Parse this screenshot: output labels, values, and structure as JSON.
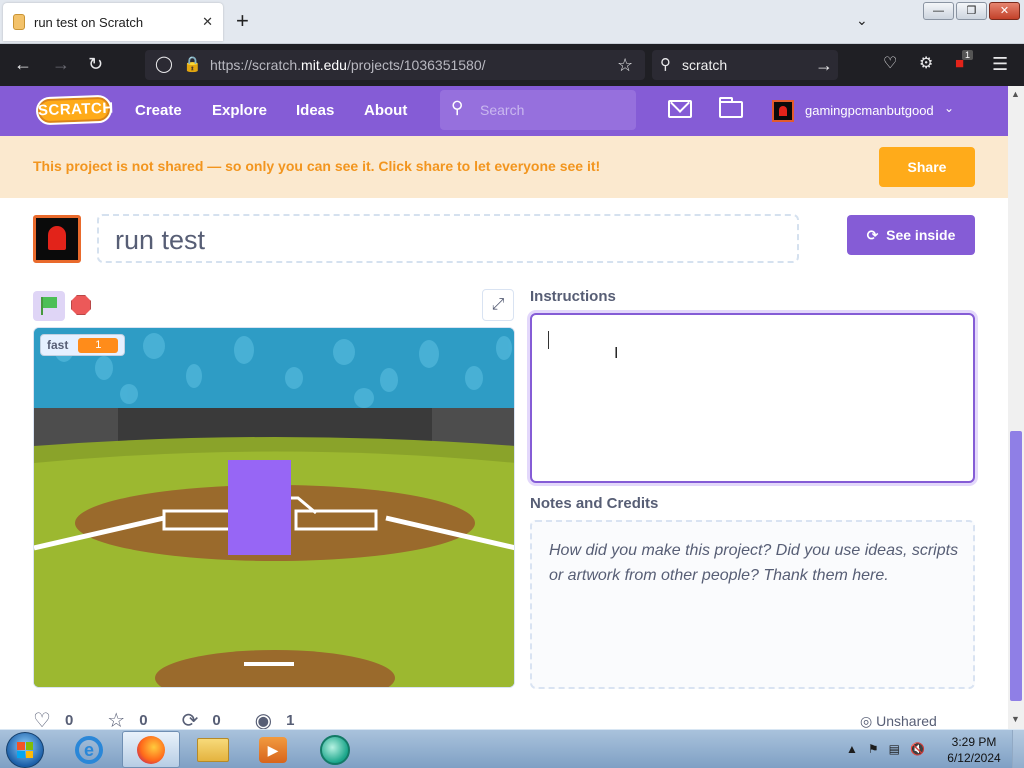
{
  "browser": {
    "tab_title": "run test on Scratch",
    "tab_close": "✕",
    "new_tab": "+",
    "tab_list": "⌄",
    "url_prefix": "https://scratch.",
    "url_host": "mit.edu",
    "url_path": "/projects/1036351580/",
    "search_text": "scratch",
    "window_buttons": [
      "—",
      "❐",
      "✕"
    ],
    "extensions_badge": "1"
  },
  "scratch_header": {
    "logo": "SCRATCH",
    "nav": [
      "Create",
      "Explore",
      "Ideas",
      "About"
    ],
    "search_placeholder": "Search",
    "username": "gamingpcmanbutgood"
  },
  "banner": {
    "message": "This project is not shared — so only you can see it. Click share to let everyone see it!",
    "share_label": "Share"
  },
  "project": {
    "title": "run test",
    "see_inside_label": "See inside",
    "variable_monitor": {
      "name": "fast",
      "value": "1"
    },
    "instructions_label": "Instructions",
    "instructions_value": "",
    "notes_label": "Notes and Credits",
    "notes_placeholder": "How did you make this project? Did you use ideas, scripts or artwork from other people? Thank them here.",
    "stats": {
      "loves": "0",
      "favorites": "0",
      "remixes": "0",
      "views": "1"
    },
    "share_status": "Unshared"
  },
  "taskbar": {
    "time": "3:29 PM",
    "date": "6/12/2024"
  },
  "colors": {
    "scratch_purple": "#855cd6",
    "share_orange": "#ffab1a",
    "banner_bg": "#fbe9cf",
    "banner_text": "#f2951e"
  }
}
